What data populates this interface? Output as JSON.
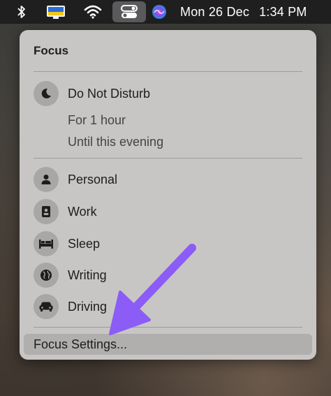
{
  "menubar": {
    "date": "Mon 26 Dec",
    "time": "1:34 PM",
    "icons": [
      "bluetooth-icon",
      "display-icon",
      "wifi-icon",
      "control-center-icon",
      "siri-icon"
    ]
  },
  "focus_menu": {
    "title": "Focus",
    "do_not_disturb": {
      "label": "Do Not Disturb",
      "options": [
        "For 1 hour",
        "Until this evening"
      ]
    },
    "modes": [
      {
        "label": "Personal",
        "icon": "person-icon"
      },
      {
        "label": "Work",
        "icon": "badge-icon"
      },
      {
        "label": "Sleep",
        "icon": "bed-icon"
      },
      {
        "label": "Writing",
        "icon": "globe-icon"
      },
      {
        "label": "Driving",
        "icon": "car-icon"
      }
    ],
    "settings_label": "Focus Settings..."
  },
  "colors": {
    "menubar": "#1f1f20",
    "panel": "#c8c6c4",
    "highlight": "#b1afad",
    "annotation_arrow": "#8b5cf6"
  }
}
